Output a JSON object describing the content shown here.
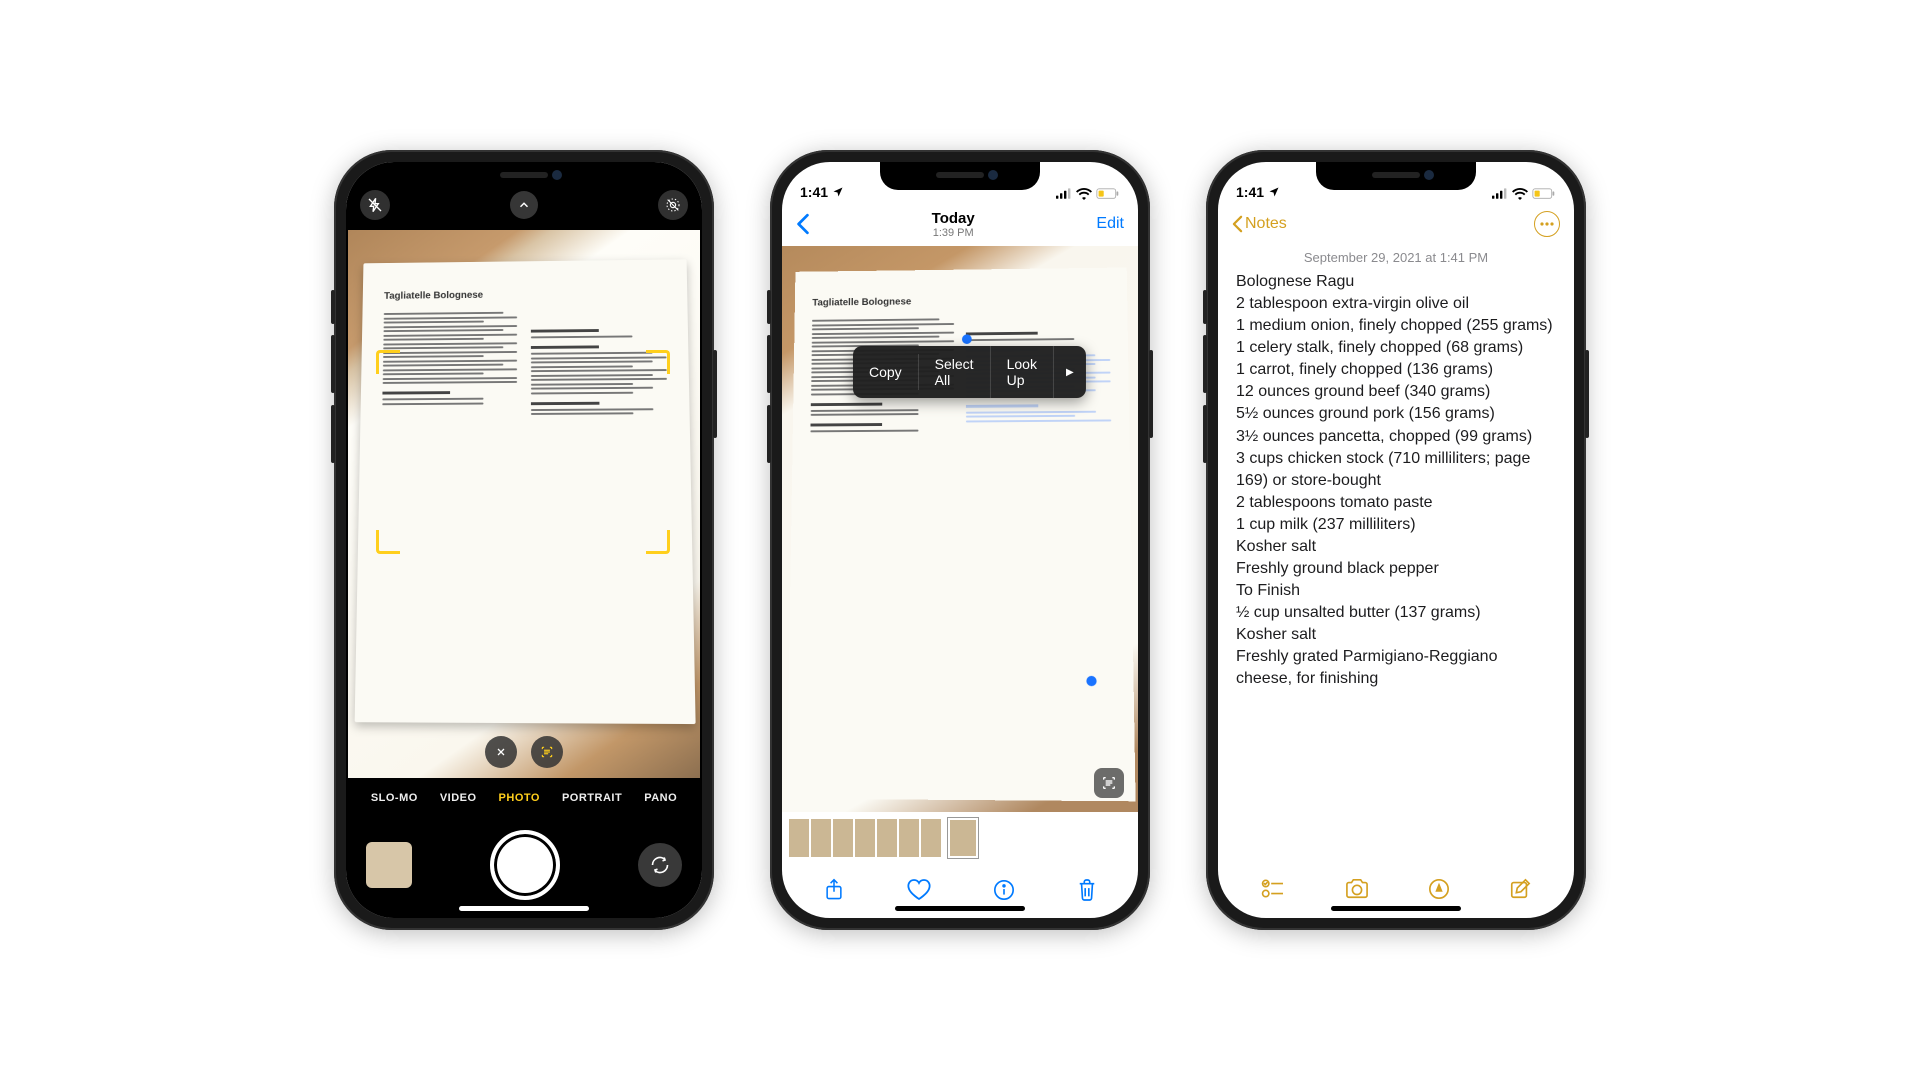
{
  "camera": {
    "book_title": "Tagliatelle Bolognese",
    "close_label": "×",
    "modes": {
      "slomo": "SLO-MO",
      "video": "VIDEO",
      "photo": "PHOTO",
      "portrait": "PORTRAIT",
      "pano": "PANO"
    }
  },
  "photos": {
    "time": "1:41",
    "title": "Today",
    "subtitle": "1:39 PM",
    "edit": "Edit",
    "book_title": "Tagliatelle Bolognese",
    "menu": {
      "copy": "Copy",
      "select_all": "Select All",
      "look_up": "Look Up",
      "more": "▶"
    }
  },
  "notes": {
    "time": "1:41",
    "back": "Notes",
    "date": "September 29, 2021 at 1:41 PM",
    "lines": [
      "Bolognese Ragu",
      "2 tablespoon extra-virgin olive oil",
      "1 medium onion, finely chopped (255 grams)",
      "1 celery stalk, finely chopped (68 grams)",
      "1 carrot, finely chopped (136 grams)",
      "12 ounces ground beef (340 grams)",
      "5½ ounces ground pork (156 grams)",
      "3½ ounces pancetta, chopped (99 grams)",
      "3 cups chicken stock (710 milliliters; page 169) or store-bought",
      "2 tablespoons tomato paste",
      "1 cup milk (237 milliliters)",
      "Kosher salt",
      "Freshly ground black pepper",
      "To Finish",
      "½ cup unsalted butter (137 grams)",
      "Kosher salt",
      "Freshly grated Parmigiano-Reggiano cheese, for finishing"
    ]
  }
}
